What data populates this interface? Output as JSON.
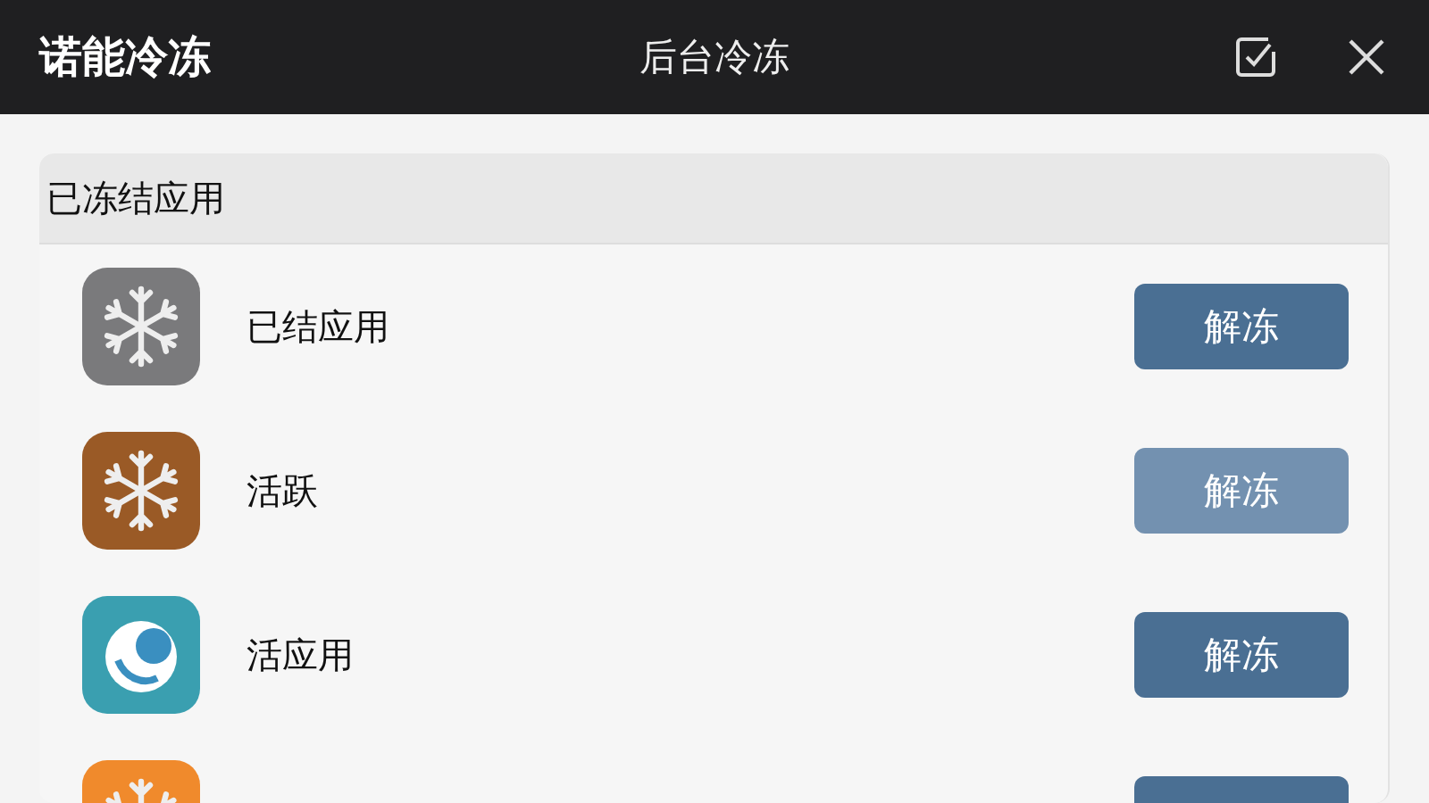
{
  "header": {
    "app_name": "诺能冷冻",
    "title": "后台冷冻"
  },
  "section": {
    "title": "已冻结应用"
  },
  "apps": [
    {
      "name": "已结应用",
      "kind": "snowflake",
      "color": "#7a7a7c",
      "button": {
        "label": "解冻",
        "disabled": false
      }
    },
    {
      "name": "活跃",
      "kind": "snowflake",
      "color": "#9a5a26",
      "button": {
        "label": "解冻",
        "disabled": true
      }
    },
    {
      "name": "活应用",
      "kind": "swirl",
      "color": "#3a9fb0",
      "button": {
        "label": "解冻",
        "disabled": false
      }
    },
    {
      "kind": "snowflake",
      "color": "#f08a2c",
      "button": {
        "disabled": false
      }
    }
  ]
}
